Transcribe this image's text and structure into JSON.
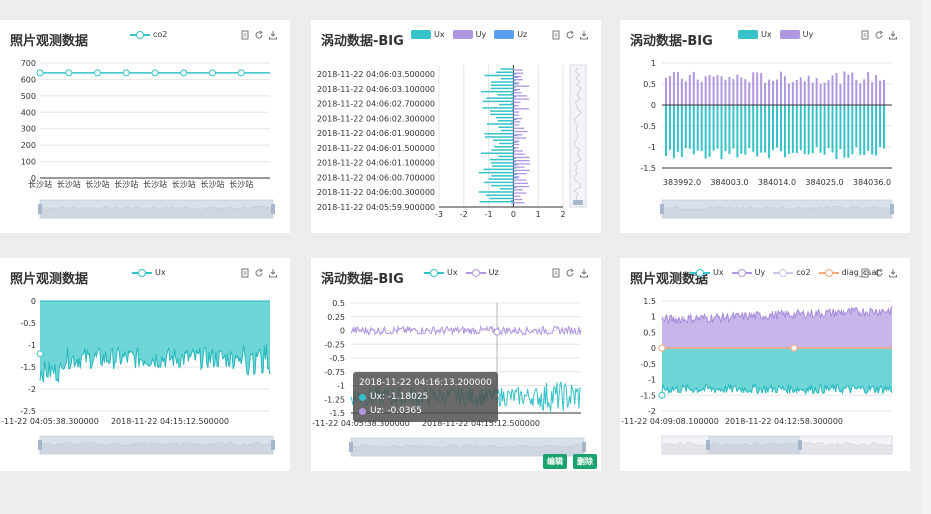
{
  "panels": [
    {
      "title": "照片观测数据",
      "legend": [
        {
          "name": "co2",
          "color": "#35c2c8",
          "shape": "line"
        }
      ]
    },
    {
      "title": "涡动数据-BIG",
      "legend": [
        {
          "name": "Ux",
          "color": "#35c2c8",
          "shape": "rect"
        },
        {
          "name": "Uy",
          "color": "#b196e0",
          "shape": "rect"
        },
        {
          "name": "Uz",
          "color": "#5b9ef0",
          "shape": "rect"
        }
      ]
    },
    {
      "title": "涡动数据-BIG",
      "legend": [
        {
          "name": "Ux",
          "color": "#35c2c8",
          "shape": "rect"
        },
        {
          "name": "Uy",
          "color": "#b196e0",
          "shape": "rect"
        }
      ]
    },
    {
      "title": "照片观测数据",
      "legend": [
        {
          "name": "Ux",
          "color": "#35c2c8",
          "shape": "line"
        }
      ]
    },
    {
      "title": "涡动数据-BIG",
      "legend": [
        {
          "name": "Ux",
          "color": "#35c2c8",
          "shape": "line"
        },
        {
          "name": "Uz",
          "color": "#b196e0",
          "shape": "line"
        }
      ]
    },
    {
      "title": "照片观测数据",
      "legend": [
        {
          "name": "Ux",
          "color": "#35c2c8",
          "shape": "line"
        },
        {
          "name": "Uy",
          "color": "#b196e0",
          "shape": "line"
        },
        {
          "name": "co2",
          "color": "#c7c7e8",
          "shape": "line"
        },
        {
          "name": "diag_csat",
          "color": "#f5a878",
          "shape": "line"
        }
      ]
    }
  ],
  "chart_data": [
    {
      "type": "line",
      "series": [
        {
          "name": "co2",
          "values": [
            640,
            640,
            640,
            640,
            640,
            640,
            640,
            640
          ]
        }
      ],
      "categories": [
        "长沙站",
        "长沙站",
        "长沙站",
        "长沙站",
        "长沙站",
        "长沙站",
        "长沙站",
        "长沙站"
      ],
      "yticks": [
        "0",
        "100",
        "200",
        "300",
        "400",
        "500",
        "600",
        "700"
      ],
      "ylim": [
        0,
        700
      ]
    },
    {
      "type": "bar",
      "orientation": "horizontal",
      "categories": [
        "2018-11-22 04:06:03.500000",
        "2018-11-22 04:06:03.100000",
        "2018-11-22 04:06:02.700000",
        "2018-11-22 04:06:02.300000",
        "2018-11-22 04:06:01.900000",
        "2018-11-22 04:06:01.500000",
        "2018-11-22 04:06:01.100000",
        "2018-11-22 04:06:00.700000",
        "2018-11-22 04:06:00.300000",
        "2018-11-22 04:05:59.900000"
      ],
      "xticks": [
        "-3",
        "-2",
        "-1",
        "0",
        "1",
        "2"
      ],
      "xlim": [
        -3,
        2
      ]
    },
    {
      "type": "bar",
      "xticks": [
        "383992.0",
        "384003.0",
        "384014.0",
        "384025.0",
        "384036.0"
      ],
      "yticks": [
        "1",
        "0.5",
        "0",
        "-0.5",
        "-1",
        "-1.5"
      ],
      "ylim": [
        -1.5,
        1
      ],
      "series": [
        {
          "name": "Ux",
          "range": [
            -1.3,
            -1.0
          ]
        },
        {
          "name": "Uy",
          "range": [
            0.5,
            0.8
          ]
        }
      ]
    },
    {
      "type": "area",
      "yticks": [
        "0",
        "-0.5",
        "-1",
        "-1.5",
        "-2",
        "-2.5"
      ],
      "ylim": [
        -2.5,
        0
      ],
      "xticks": [
        "-11-22 04:05:38.300000",
        "2018-11-22 04:15:12.500000"
      ],
      "series": [
        {
          "name": "Ux",
          "level": -1.3
        }
      ]
    },
    {
      "type": "line",
      "yticks": [
        "0.5",
        "0.25",
        "0",
        "-0.25",
        "-0.5",
        "-0.75",
        "-1",
        "-1.25",
        "-1.5"
      ],
      "ylim": [
        -1.5,
        0.5
      ],
      "xticks": [
        "-11-22 04:05:38.300000",
        "2018-11-22 04:15:12.500000"
      ],
      "series": [
        {
          "name": "Ux",
          "level": -1.2
        },
        {
          "name": "Uz",
          "level": 0
        }
      ]
    },
    {
      "type": "area",
      "yticks": [
        "1.5",
        "1",
        "0.5",
        "0",
        "-0.5",
        "-1",
        "-1.5",
        "-2"
      ],
      "ylim": [
        -2,
        1.5
      ],
      "xticks": [
        "-11-22 04:09:08.100000",
        "2018-11-22 04:12:58.300000"
      ],
      "series": [
        {
          "name": "Ux",
          "level": -1.3
        },
        {
          "name": "Uy",
          "level": 0.9
        },
        {
          "name": "co2",
          "level": 0
        },
        {
          "name": "diag_csat",
          "level": 0
        }
      ]
    }
  ],
  "tooltip": {
    "time": "2018-11-22 04:16:13.200000",
    "rows": [
      {
        "label": "Ux: -1.18025",
        "color": "#35c2c8"
      },
      {
        "label": "Uz: -0.0365",
        "color": "#b196e0"
      }
    ]
  },
  "buttons": {
    "edit": "编辑",
    "delete": "删除"
  }
}
